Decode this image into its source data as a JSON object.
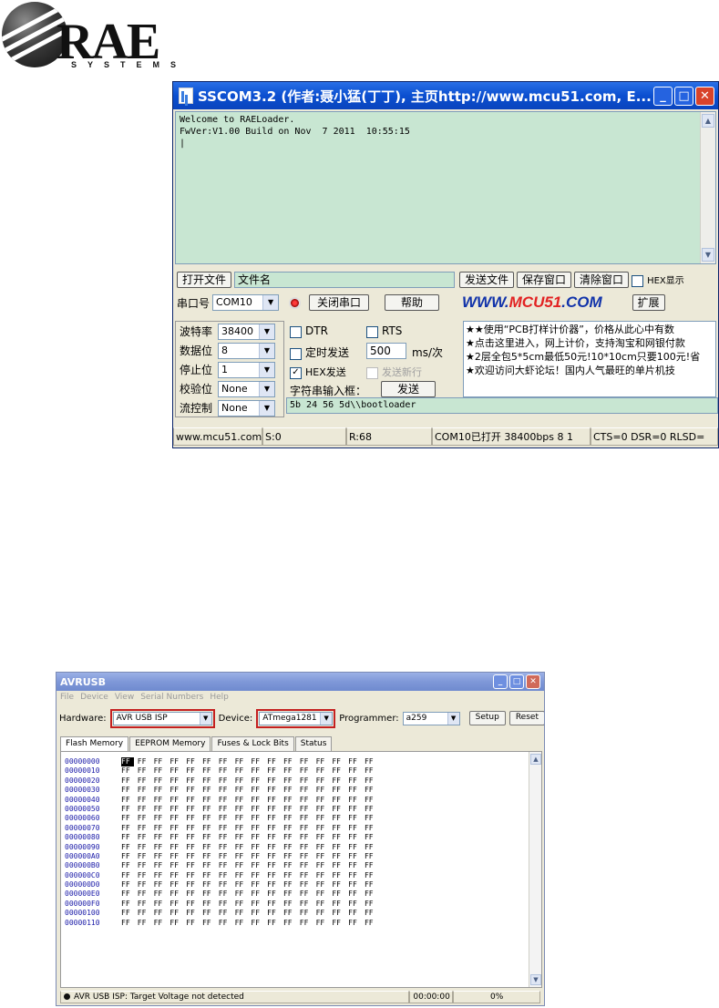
{
  "logo": {
    "brand": "RAE",
    "sub": "SYSTEMS"
  },
  "sscom": {
    "title": "SSCOM3.2 (作者:聂小猛(丁丁), 主页http://www.mcu51.com, E...",
    "output_text": "Welcome to RAELoader.\nFwVer:V1.00 Build on Nov  7 2011  10:55:15\n|",
    "open_file_label": "打开文件",
    "filename_value": "文件名",
    "send_file_label": "发送文件",
    "save_window_label": "保存窗口",
    "clear_window_label": "清除窗口",
    "hex_display_label": "HEX显示",
    "port_label": "串口号",
    "port_value": "COM10",
    "close_port_label": "关闭串口",
    "help_label": "帮助",
    "brand_prefix": "WWW.",
    "brand_mid": "MCU51",
    "brand_suffix": ".COM",
    "expand_label": "扩展",
    "baud_label": "波特率",
    "baud_value": "38400",
    "databits_label": "数据位",
    "databits_value": "8",
    "stopbits_label": "停止位",
    "stopbits_value": "1",
    "parity_label": "校验位",
    "parity_value": "None",
    "flow_label": "流控制",
    "flow_value": "None",
    "dtr_label": "DTR",
    "rts_label": "RTS",
    "timed_send_label": "定时发送",
    "interval_value": "500",
    "interval_unit": "ms/次",
    "hex_send_label": "HEX发送",
    "send_newline_label": "发送新行",
    "input_label": "字符串输入框：",
    "send_label": "发送",
    "send_input_value": "5b 24 56 5d\\\\bootloader",
    "ad_lines": [
      "★★使用“PCB打样计价器”，价格从此心中有数",
      "★点击这里进入，网上计价，支持淘宝和网银付款",
      "★2层全包5*5cm最低50元!10*10cm只要100元!省",
      "★欢迎访问大虾论坛！国内人气最旺的单片机技"
    ],
    "status": [
      "www.mcu51.com",
      "S:0",
      "R:68",
      "COM10已打开  38400bps  8 1",
      "CTS=0 DSR=0 RLSD="
    ]
  },
  "avr": {
    "title": "AVRUSB",
    "menu": [
      "File",
      "Device",
      "View",
      "Serial Numbers",
      "Help"
    ],
    "hardware_label": "Hardware:",
    "hardware_value": "AVR USB ISP",
    "device_label": "Device:",
    "device_value": "ATmega1281",
    "programmer_label": "Programmer:",
    "programmer_value": "a259",
    "setup_label": "Setup",
    "reset_label": "Reset",
    "tabs": [
      "Flash Memory",
      "EEPROM Memory",
      "Fuses & Lock Bits",
      "Status"
    ],
    "addresses": [
      "00000000",
      "00000010",
      "00000020",
      "00000030",
      "00000040",
      "00000050",
      "00000060",
      "00000070",
      "00000080",
      "00000090",
      "000000A0",
      "000000B0",
      "000000C0",
      "000000D0",
      "000000E0",
      "000000F0",
      "00000100",
      "00000110"
    ],
    "byte_value": "FF",
    "status_text": "AVR USB ISP: Target Voltage not detected",
    "status_time": "00:00:00",
    "status_percent": "0%"
  }
}
